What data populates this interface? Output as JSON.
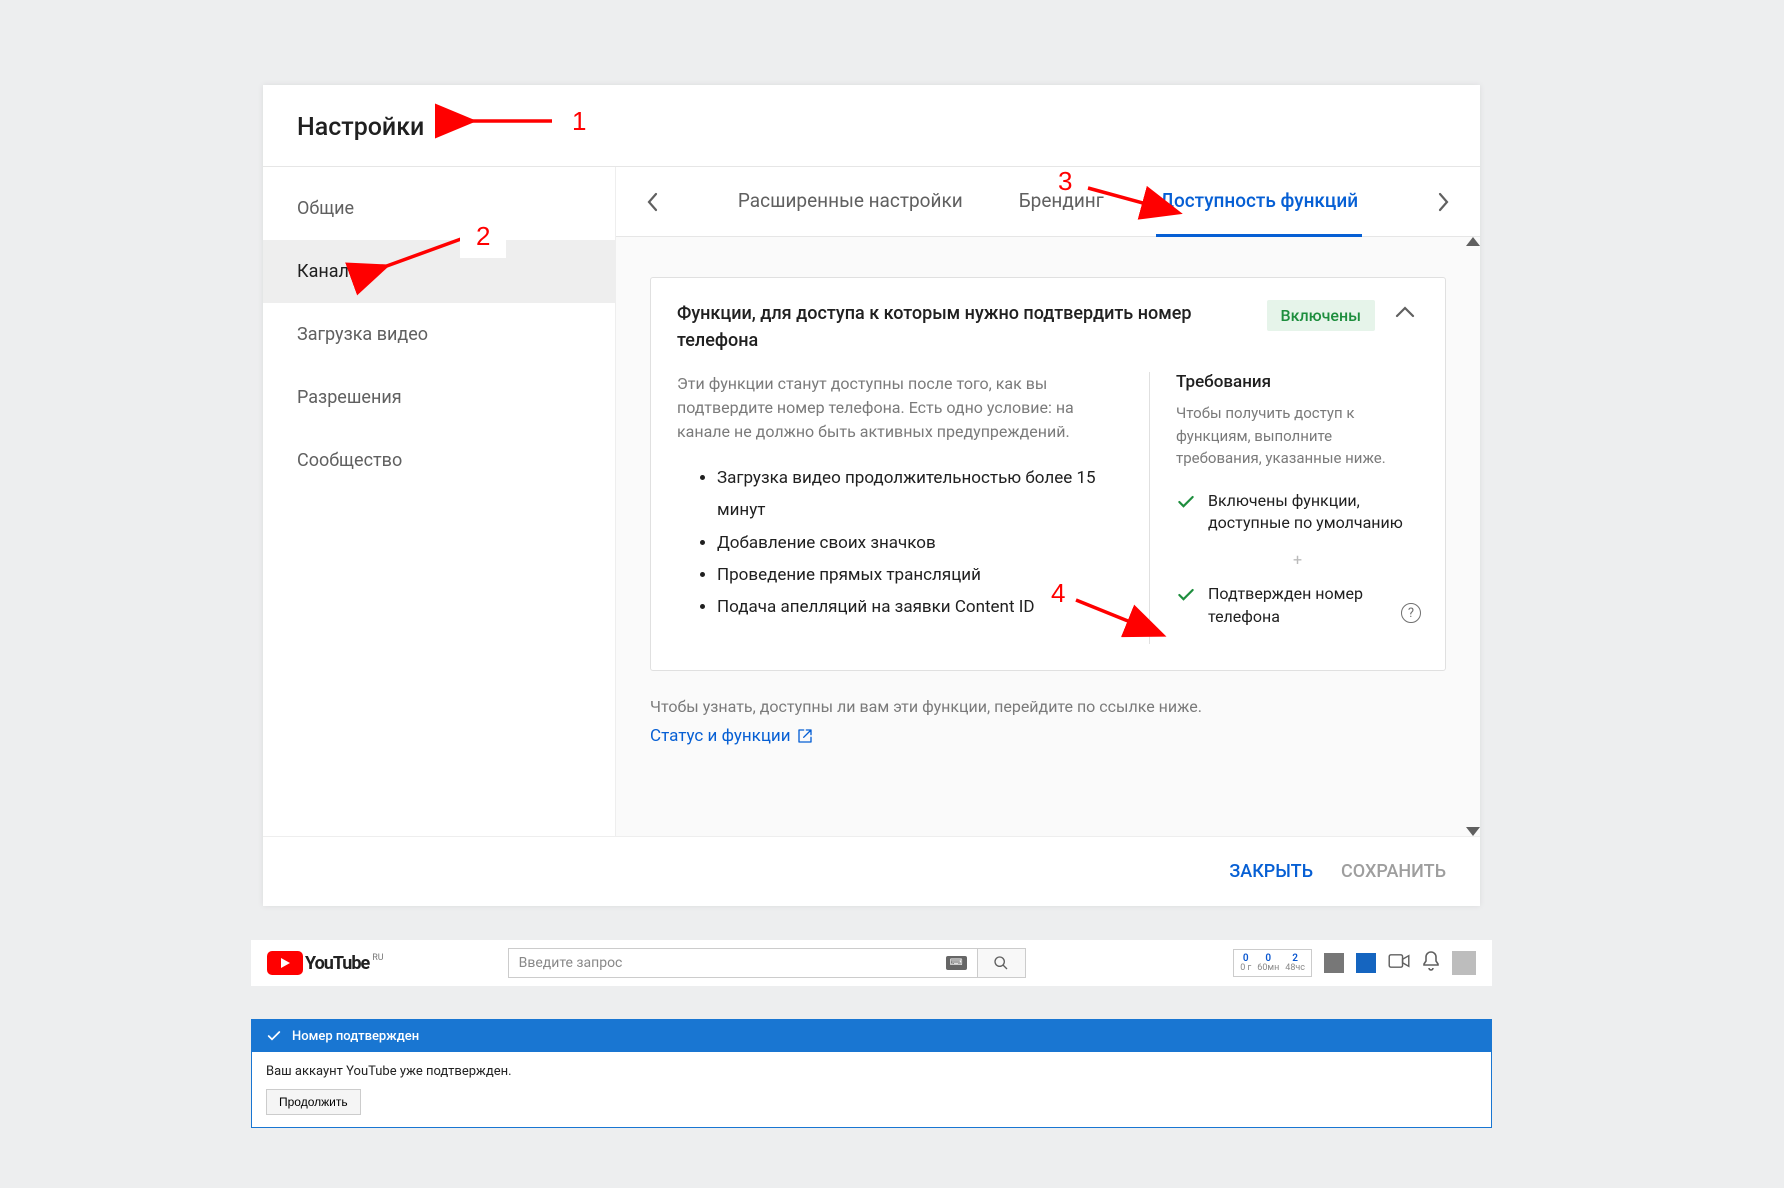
{
  "dialog": {
    "title": "Настройки",
    "sidebar": [
      {
        "id": "general",
        "label": "Общие"
      },
      {
        "id": "channel",
        "label": "Канал"
      },
      {
        "id": "upload",
        "label": "Загрузка видео"
      },
      {
        "id": "perm",
        "label": "Разрешения"
      },
      {
        "id": "community",
        "label": "Сообщество"
      }
    ],
    "active_sidebar": "channel",
    "tabs": [
      {
        "id": "advanced",
        "label": "Расширенные настройки"
      },
      {
        "id": "branding",
        "label": "Брендинг"
      },
      {
        "id": "features",
        "label": "Доступность функций"
      }
    ],
    "active_tab": "features",
    "card": {
      "title": "Функции, для доступа к которым нужно подтвердить номер телефона",
      "badge": "Включены",
      "description": "Эти функции станут доступны после того, как вы подтвердите номер телефона. Есть одно условие: на канале не должно быть активных предупреждений.",
      "bullets": [
        "Загрузка видео продолжительностью более 15 минут",
        "Добавление своих значков",
        "Проведение прямых трансляций",
        "Подача апелляций на заявки Content ID"
      ],
      "req_title": "Требования",
      "req_desc": "Чтобы получить доступ к функциям, выполните требования, указанные ниже.",
      "req_items": [
        "Включены функции, доступные по умолчанию",
        "Подтвержден номер телефона"
      ]
    },
    "footnote": "Чтобы узнать, доступны ли вам эти функции, перейдите по ссылке ниже.",
    "link": "Статус и функции",
    "actions": {
      "close": "ЗАКРЫТЬ",
      "save": "СОХРАНИТЬ"
    }
  },
  "annotations": {
    "n1": "1",
    "n2": "2",
    "n3": "3",
    "n4": "4"
  },
  "ytbar": {
    "brand": "YouTube",
    "region": "RU",
    "search_placeholder": "Введите запрос",
    "meter": [
      {
        "n": "0",
        "u": "0 г"
      },
      {
        "n": "0",
        "u": "60мн"
      },
      {
        "n": "2",
        "u": "48чс"
      }
    ]
  },
  "verify": {
    "head": "Номер подтвержден",
    "body": "Ваш аккаунт YouTube уже подтвержден.",
    "button": "Продолжить"
  }
}
